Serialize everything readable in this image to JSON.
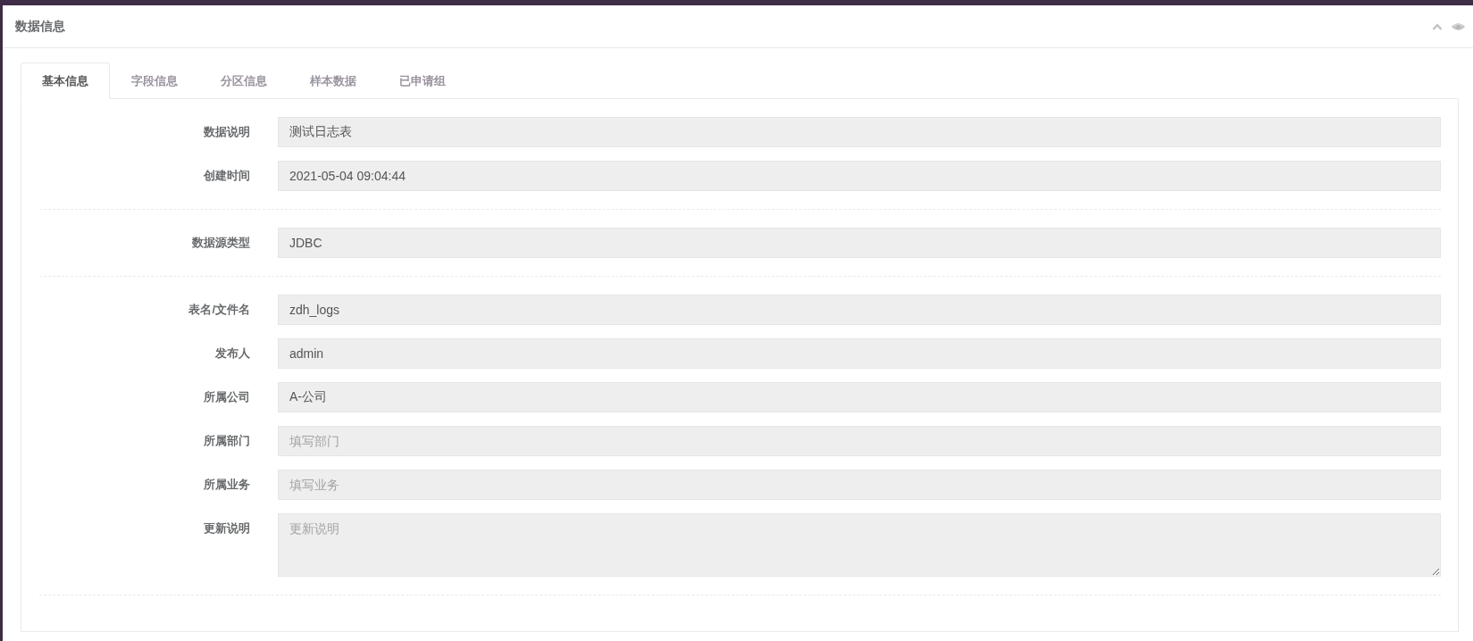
{
  "panel": {
    "title": "数据信息"
  },
  "tabs": [
    {
      "label": "基本信息",
      "selected": true
    },
    {
      "label": "字段信息",
      "selected": false
    },
    {
      "label": "分区信息",
      "selected": false
    },
    {
      "label": "样本数据",
      "selected": false
    },
    {
      "label": "已申请组",
      "selected": false
    }
  ],
  "form": {
    "groups": [
      {
        "fields": [
          {
            "label": "数据说明",
            "kind": "input",
            "value": "测试日志表",
            "disabled": true
          },
          {
            "label": "创建时间",
            "kind": "input",
            "value": "2021-05-04 09:04:44",
            "disabled": true
          }
        ]
      },
      {
        "fields": [
          {
            "label": "数据源类型",
            "kind": "input",
            "value": "JDBC",
            "disabled": true
          }
        ]
      },
      {
        "fields": [
          {
            "label": "表名/文件名",
            "kind": "input",
            "value": "zdh_logs",
            "disabled": true
          },
          {
            "label": "发布人",
            "kind": "input",
            "value": "admin",
            "disabled": true
          },
          {
            "label": "所属公司",
            "kind": "input",
            "value": "A-公司",
            "disabled": true
          },
          {
            "label": "所属部门",
            "kind": "input",
            "placeholder": "填写部门",
            "disabled": true
          },
          {
            "label": "所属业务",
            "kind": "input",
            "placeholder": "填写业务",
            "disabled": true
          },
          {
            "label": "更新说明",
            "kind": "textarea",
            "placeholder": "更新说明",
            "disabled": true
          }
        ]
      }
    ]
  }
}
